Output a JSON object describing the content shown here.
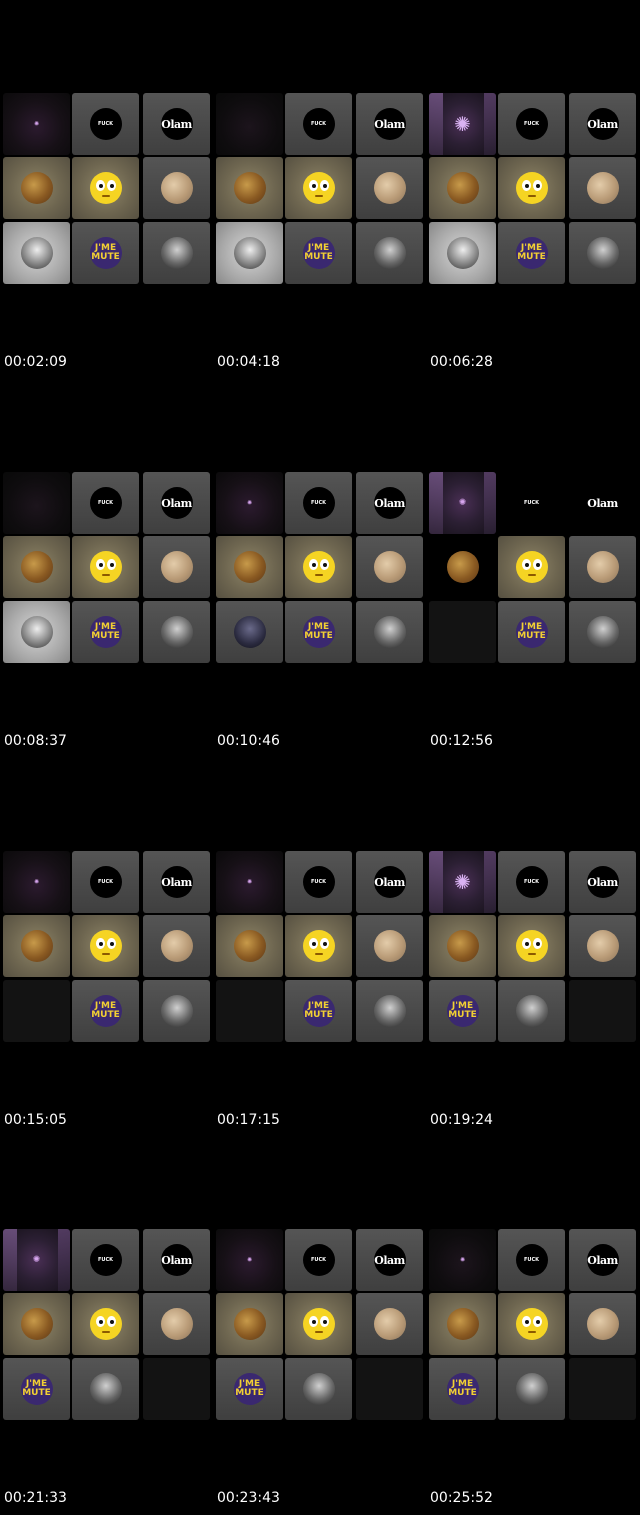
{
  "labels": {
    "a": "J'ME",
    "b": "MUTE",
    "olam": "Olam",
    "fuck": "FUCK"
  },
  "frames": [
    {
      "timestamp": "00:02:09",
      "tiles": [
        "purple-dim:star-small",
        "gray:fk",
        "gray:olam",
        "beige:toy",
        "beige:emoji",
        "gray:sand",
        "white:bw",
        "gray:mute",
        "gray:bw2"
      ]
    },
    {
      "timestamp": "00:04:18",
      "tiles": [
        "purple-faint:none",
        "gray:fk",
        "gray:olam",
        "beige:toy",
        "beige:emoji",
        "gray:sand",
        "white:bw",
        "gray:mute",
        "gray:bw2"
      ]
    },
    {
      "timestamp": "00:06:28",
      "tiles": [
        "purple-bright:star-big",
        "gray:fk",
        "gray:olam",
        "beige:toy",
        "beige:emoji",
        "gray:sand",
        "white:bw",
        "gray:mute",
        "gray:bw2"
      ]
    },
    {
      "timestamp": "00:08:37",
      "tiles": [
        "purple-faint:none",
        "gray:fk",
        "gray:olam",
        "beige:toy",
        "beige:emoji",
        "gray:sand",
        "white:bw",
        "gray:mute",
        "gray:bw2"
      ]
    },
    {
      "timestamp": "00:10:46",
      "tiles": [
        "purple-dim:star-small",
        "gray:fk",
        "gray:olam",
        "beige:toy",
        "beige:emoji",
        "gray:sand",
        "gray:night",
        "gray:mute",
        "gray:bw2"
      ]
    },
    {
      "timestamp": "00:12:56",
      "tiles": [
        "purple-bright:star-mid",
        "black:fk",
        "black:olam",
        "black:toy",
        "beige:emoji",
        "gray:sand",
        "dark:none",
        "gray:mute",
        "gray:bw2"
      ]
    },
    {
      "timestamp": "00:15:05",
      "tiles": [
        "purple-dim:star-small",
        "gray:fk",
        "gray:olam",
        "beige:toy",
        "beige:emoji",
        "gray:sand",
        "dark:none",
        "gray:mute",
        "gray:bw2"
      ]
    },
    {
      "timestamp": "00:17:15",
      "tiles": [
        "purple-dim:star-small",
        "gray:fk",
        "gray:olam",
        "beige:toy",
        "beige:emoji",
        "gray:sand",
        "dark:none",
        "gray:mute",
        "gray:bw2"
      ]
    },
    {
      "timestamp": "00:19:24",
      "tiles": [
        "purple-bright:star-big",
        "gray:fk",
        "gray:olam",
        "beige:toy",
        "beige:emoji",
        "gray:sand",
        "gray:mute",
        "gray:bw2",
        "dark:none"
      ]
    },
    {
      "timestamp": "00:21:33",
      "tiles": [
        "purple-bright:star-mid",
        "gray:fk",
        "gray:olam",
        "beige:toy",
        "beige:emoji",
        "gray:sand",
        "gray:mute",
        "gray:bw2",
        "dark:none"
      ]
    },
    {
      "timestamp": "00:23:43",
      "tiles": [
        "purple-dim:star-small",
        "gray:fk",
        "gray:olam",
        "beige:toy",
        "beige:emoji",
        "gray:sand",
        "gray:mute",
        "gray:bw2",
        "dark:none"
      ]
    },
    {
      "timestamp": "00:25:52",
      "tiles": [
        "purple-faint:star-small",
        "gray:fk",
        "gray:olam",
        "beige:toy",
        "beige:emoji",
        "gray:sand",
        "gray:mute",
        "gray:bw2",
        "dark:none"
      ]
    }
  ]
}
